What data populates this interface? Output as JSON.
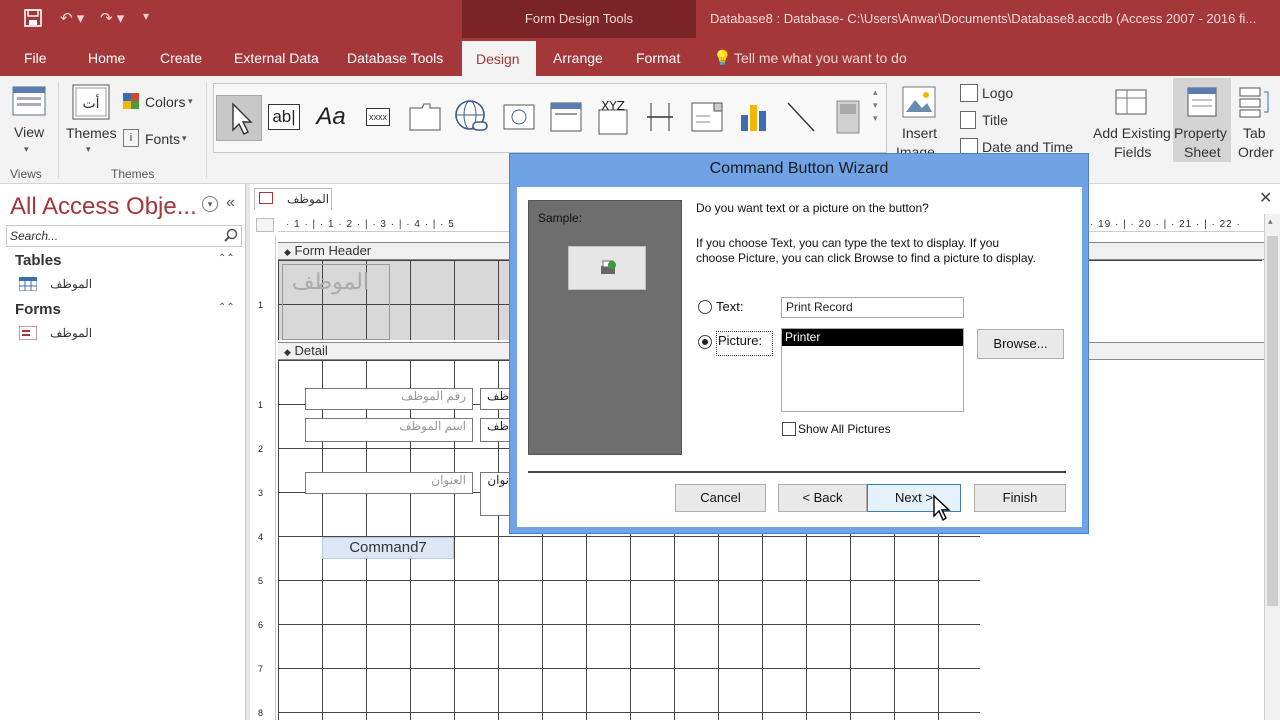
{
  "title_bar": {
    "context_tab": "Form Design Tools",
    "document_title": "Database8 : Database- C:\\Users\\Anwar\\Documents\\Database8.accdb (Access 2007 - 2016 fi..."
  },
  "tabs": [
    "File",
    "Home",
    "Create",
    "External Data",
    "Database Tools",
    "Design",
    "Arrange",
    "Format"
  ],
  "tell_me": "Tell me what you want to do",
  "ribbon": {
    "view": "View",
    "views_group": "Views",
    "themes": "Themes",
    "colors": "Colors",
    "fonts": "Fonts",
    "themes_group": "Themes",
    "insert_image_1": "Insert",
    "insert_image_2": "Image",
    "logo": "Logo",
    "title": "Title",
    "date_time": "Date and Time",
    "add_existing_1": "Add Existing",
    "add_existing_2": "Fields",
    "property_1": "Property",
    "property_2": "Sheet",
    "tab_order_1": "Tab",
    "tab_order_2": "Order",
    "gallery": {
      "text_box": "ab|",
      "label": "Aa",
      "xxxx": "xxxx",
      "xyz": "XYZ"
    }
  },
  "nav": {
    "title": "All Access Obje...",
    "search_placeholder": "Search...",
    "tables_header": "Tables",
    "table_item": "الموظف",
    "forms_header": "Forms",
    "form_item": "الموظف"
  },
  "document": {
    "tab_label": "الموظف",
    "ruler_left": "· 1 · | · 1 · 2 · | · 3 · | · 4 · | · 5",
    "ruler_right": "· 19 · | · 20 · | · 21 · | · 22 ·",
    "form_header": "Form Header",
    "header_label": "الموظف",
    "detail": "Detail",
    "field1": "رقم الموظف",
    "field2": "اسم الموظف",
    "field3": "العنوان",
    "label1": "ظف",
    "label2": "ظف",
    "label3": "نوان",
    "command_button": "Command7"
  },
  "dialog": {
    "title": "Command Button Wizard",
    "sample_label": "Sample:",
    "question": "Do you want text or a picture on the button?",
    "help_line1": "If you choose Text, you can type the text to display.  If you",
    "help_line2": "choose Picture, you can click Browse to find a picture to display.",
    "text_option": "Text:",
    "text_value": "Print Record",
    "picture_option": "Picture:",
    "picture_selected": "Printer",
    "browse": "Browse...",
    "show_all": "Show All Pictures",
    "cancel": "Cancel",
    "back": "< Back",
    "next": "Next >",
    "finish": "Finish",
    "selected_option": "picture"
  },
  "colors": {
    "accent": "#a4373a",
    "dialog_frame": "#6fa3e6",
    "selection": "#000000"
  }
}
